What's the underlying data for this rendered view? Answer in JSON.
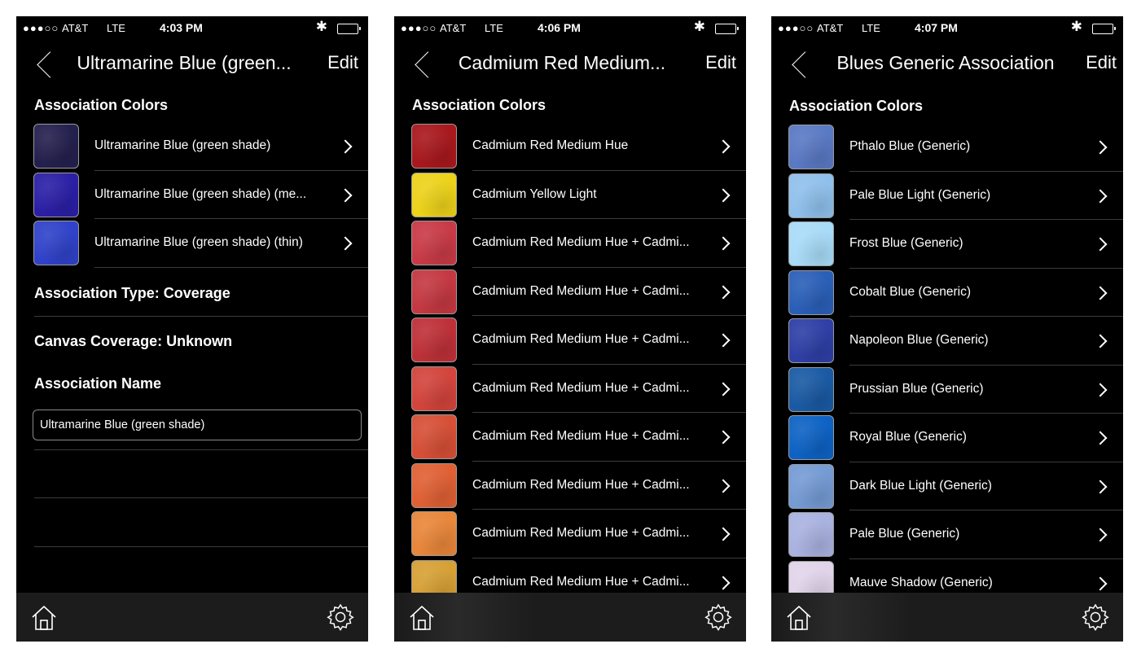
{
  "screens": [
    {
      "status": {
        "signal": "●●●○○",
        "carrier": "AT&T",
        "network": "LTE",
        "time": "4:03 PM",
        "bluetooth": "✱"
      },
      "nav": {
        "title": "Ultramarine Blue (green...",
        "edit_label": "Edit"
      },
      "section_title": "Association Colors",
      "items": [
        {
          "label": "Ultramarine Blue (green shade)",
          "color": "#24204e"
        },
        {
          "label": "Ultramarine Blue (green shade) (me...",
          "color": "#2b1fa6"
        },
        {
          "label": "Ultramarine Blue (green shade) (thin)",
          "color": "#3042c9"
        }
      ],
      "association_type": "Association Type: Coverage",
      "canvas_coverage": "Canvas Coverage: Unknown",
      "association_name_label": "Association Name",
      "association_name_value": "Ultramarine Blue (green shade)"
    },
    {
      "status": {
        "signal": "●●●○○",
        "carrier": "AT&T",
        "network": "LTE",
        "time": "4:06 PM",
        "bluetooth": "✱"
      },
      "nav": {
        "title": "Cadmium Red Medium...",
        "edit_label": "Edit"
      },
      "section_title": "Association Colors",
      "items": [
        {
          "label": "Cadmium Red Medium Hue",
          "color": "#a8181d"
        },
        {
          "label": "Cadmium Yellow Light",
          "color": "#ecd21a"
        },
        {
          "label": "Cadmium Red Medium Hue + Cadmi...",
          "color": "#c83a46"
        },
        {
          "label": "Cadmium Red Medium Hue + Cadmi...",
          "color": "#c43841"
        },
        {
          "label": "Cadmium Red Medium Hue + Cadmi...",
          "color": "#be3038"
        },
        {
          "label": "Cadmium Red Medium Hue + Cadmi...",
          "color": "#d2443c"
        },
        {
          "label": "Cadmium Red Medium Hue + Cadmi...",
          "color": "#d64f36"
        },
        {
          "label": "Cadmium Red Medium Hue + Cadmi...",
          "color": "#e06034"
        },
        {
          "label": "Cadmium Red Medium Hue + Cadmi...",
          "color": "#e8863a"
        },
        {
          "label": "Cadmium Red Medium Hue + Cadmi...",
          "color": "#d6a035"
        }
      ]
    },
    {
      "status": {
        "signal": "●●●○○",
        "carrier": "AT&T",
        "network": "LTE",
        "time": "4:07 PM",
        "bluetooth": "✱"
      },
      "nav": {
        "title": "Blues Generic Association",
        "edit_label": "Edit"
      },
      "section_title": "Association Colors",
      "items": [
        {
          "label": "Pthalo Blue (Generic)",
          "color": "#5a79c4"
        },
        {
          "label": "Pale Blue Light (Generic)",
          "color": "#8fc0ec"
        },
        {
          "label": "Frost Blue (Generic)",
          "color": "#a8dbf8"
        },
        {
          "label": "Cobalt Blue (Generic)",
          "color": "#2a5fb8"
        },
        {
          "label": "Napoleon Blue (Generic)",
          "color": "#2e3fa6"
        },
        {
          "label": "Prussian Blue (Generic)",
          "color": "#1a5aa4"
        },
        {
          "label": "Royal Blue (Generic)",
          "color": "#0d62c4"
        },
        {
          "label": "Dark Blue Light (Generic)",
          "color": "#759bd4"
        },
        {
          "label": "Pale Blue (Generic)",
          "color": "#a9b2e0"
        },
        {
          "label": "Mauve Shadow (Generic)",
          "color": "#e1d4ea"
        }
      ]
    }
  ],
  "icons": {
    "back": "chevron-left-icon",
    "chevron": "chevron-right-icon",
    "home": "home-icon",
    "settings": "gear-icon"
  }
}
